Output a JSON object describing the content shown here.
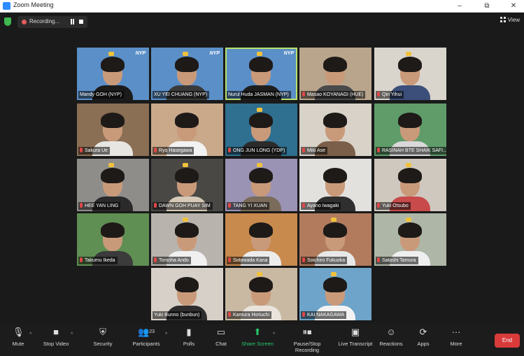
{
  "window": {
    "title": "Zoom Meeting",
    "minimize": "–",
    "maximize": "⧉",
    "close": "✕"
  },
  "topbar": {
    "recording_label": "Recording...",
    "view_label": "View"
  },
  "participants": [
    {
      "name": "Mandy GOH (NYP)",
      "bg": "#5b8fc8",
      "shirt": "#1b1b1b",
      "logo": "NYP",
      "crown": true,
      "muted": false,
      "active": false
    },
    {
      "name": "XU YEI CHUANG (NYP)",
      "bg": "#5b8fc8",
      "shirt": "#3a3a3a",
      "logo": "NYP",
      "crown": true,
      "muted": false,
      "active": false
    },
    {
      "name": "Nurul Huda JASMAN (NYP)",
      "bg": "#5b8fc8",
      "shirt": "#1e1e1e",
      "logo": "NYP",
      "crown": true,
      "muted": false,
      "active": true
    },
    {
      "name": "Masao KOYANAGI (HUE)",
      "bg": "#b9a58c",
      "shirt": "#4a4a4a",
      "logo": "",
      "crown": false,
      "muted": true,
      "active": false
    },
    {
      "name": "Qin Yihui",
      "bg": "#d9d4cc",
      "shirt": "#3b4f7a",
      "logo": "",
      "crown": true,
      "muted": true,
      "active": false
    },
    {
      "name": "Sakura Ue",
      "bg": "#8a6f55",
      "shirt": "#e8e6e2",
      "logo": "",
      "crown": false,
      "muted": true,
      "active": false
    },
    {
      "name": "Ryo Hasegawa",
      "bg": "#c9a98a",
      "shirt": "#f2f2f2",
      "logo": "",
      "crown": false,
      "muted": true,
      "active": false
    },
    {
      "name": "ONG JUN LONG (YDP)",
      "bg": "#2f6f8f",
      "shirt": "#2b2b2b",
      "logo": "",
      "crown": true,
      "muted": true,
      "active": false
    },
    {
      "name": "Miki Ase",
      "bg": "#d8d2c8",
      "shirt": "#7b5f4a",
      "logo": "",
      "crown": false,
      "muted": true,
      "active": false
    },
    {
      "name": "RASINAH BTE SHAIK SAFI...",
      "bg": "#5f9c6a",
      "shirt": "#d9d9d9",
      "logo": "",
      "crown": false,
      "muted": true,
      "active": false
    },
    {
      "name": "HEE YAN LING",
      "bg": "#8e8d8a",
      "shirt": "#2a2a2a",
      "logo": "",
      "crown": true,
      "muted": true,
      "active": false
    },
    {
      "name": "DAWN GOH PUAY SIM",
      "bg": "#4a4845",
      "shirt": "#d7c9b8",
      "logo": "",
      "crown": true,
      "muted": true,
      "active": false
    },
    {
      "name": "TANG YI XUAN",
      "bg": "#9a93b4",
      "shirt": "#7a6b5a",
      "logo": "",
      "crown": true,
      "muted": true,
      "active": false
    },
    {
      "name": "Ayano Iwagaki",
      "bg": "#e3e1de",
      "shirt": "#2f2f2f",
      "logo": "",
      "crown": false,
      "muted": true,
      "active": false
    },
    {
      "name": "Yuki Otsubo",
      "bg": "#cfc8bf",
      "shirt": "#c84a4a",
      "logo": "",
      "crown": true,
      "muted": true,
      "active": false
    },
    {
      "name": "Takumu Ikeda",
      "bg": "#5f8f52",
      "shirt": "#3b3b3b",
      "logo": "",
      "crown": false,
      "muted": true,
      "active": false
    },
    {
      "name": "Tomoha Ando",
      "bg": "#b8b3ad",
      "shirt": "#f0f0f0",
      "logo": "",
      "crown": true,
      "muted": true,
      "active": false
    },
    {
      "name": "Sotowada Kana",
      "bg": "#c98a4d",
      "shirt": "#ececec",
      "logo": "",
      "crown": false,
      "muted": true,
      "active": false
    },
    {
      "name": "Soichiro Fukuoka",
      "bg": "#b27b5e",
      "shirt": "#e8e8e8",
      "logo": "",
      "crown": true,
      "muted": true,
      "active": false
    },
    {
      "name": "Satoshi Tamura",
      "bg": "#aeb7a7",
      "shirt": "#efefef",
      "logo": "",
      "crown": true,
      "muted": true,
      "active": false
    },
    {
      "name": "Yuki Bunno (bunbun)",
      "bg": "#d7d0c8",
      "shirt": "#2d2d2d",
      "logo": "",
      "crown": false,
      "muted": false,
      "active": false
    },
    {
      "name": "Kamura Horiuchi",
      "bg": "#c9b8a2",
      "shirt": "#e9e3db",
      "logo": "",
      "crown": true,
      "muted": true,
      "active": false
    },
    {
      "name": "KAI NAKAGAWA",
      "bg": "#6ea4c9",
      "shirt": "#f2f2f2",
      "logo": "",
      "crown": true,
      "muted": true,
      "active": false
    }
  ],
  "toolbar": {
    "mute": "Mute",
    "stop_video": "Stop Video",
    "security": "Security",
    "participants": "Participants",
    "participants_count": "23",
    "polls": "Polls",
    "chat": "Chat",
    "share_screen": "Share Screen",
    "pause_recording": "Pause/Stop Recording",
    "live_transcript": "Live Transcript",
    "reactions": "Reactions",
    "apps": "Apps",
    "more": "More",
    "end": "End"
  },
  "icons": {
    "mute": "mic-icon",
    "video": "video-icon",
    "security": "shield-icon",
    "participants": "people-icon",
    "polls": "poll-icon",
    "chat": "chat-icon",
    "share": "share-icon",
    "pause": "pause-icon",
    "transcript": "cc-icon",
    "reactions": "smiley-icon",
    "apps": "apps-icon",
    "more": "ellipsis-icon"
  }
}
